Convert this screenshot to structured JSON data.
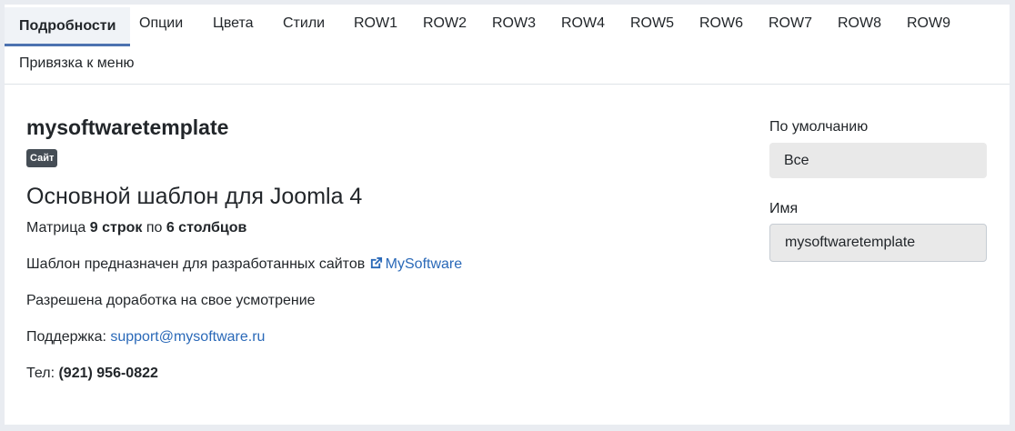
{
  "tabs": [
    {
      "label": "Подробности",
      "active": true
    },
    {
      "label": "Опции"
    },
    {
      "label": "Цвета"
    },
    {
      "label": "Стили"
    },
    {
      "label": "ROW1"
    },
    {
      "label": "ROW2"
    },
    {
      "label": "ROW3"
    },
    {
      "label": "ROW4"
    },
    {
      "label": "ROW5"
    },
    {
      "label": "ROW6"
    },
    {
      "label": "ROW7"
    },
    {
      "label": "ROW8"
    },
    {
      "label": "ROW9"
    },
    {
      "label": "Привязка к меню"
    }
  ],
  "details": {
    "template_name": "mysoftwaretemplate",
    "badge": "Сайт",
    "title": "Основной шаблон для Joomla 4",
    "matrix": {
      "prefix": "Матрица ",
      "rows": "9 строк",
      "middle": " по ",
      "cols": "6 столбцов"
    },
    "description_prefix": "Шаблон предназначен для разработанных сайтов ",
    "description_link": "MySoftware",
    "permission": "Разрешена доработка на свое усмотрение",
    "support_label": "Поддержка: ",
    "support_email": "support@mysoftware.ru",
    "phone_label": "Тел: ",
    "phone": "(921) 956-0822"
  },
  "sidebar": {
    "default_label": "По умолчанию",
    "default_value": "Все",
    "name_label": "Имя",
    "name_value": "mysoftwaretemplate"
  },
  "colors": {
    "accent": "#4c72b0",
    "link": "#2a69b8",
    "badge_bg": "#454d55"
  }
}
